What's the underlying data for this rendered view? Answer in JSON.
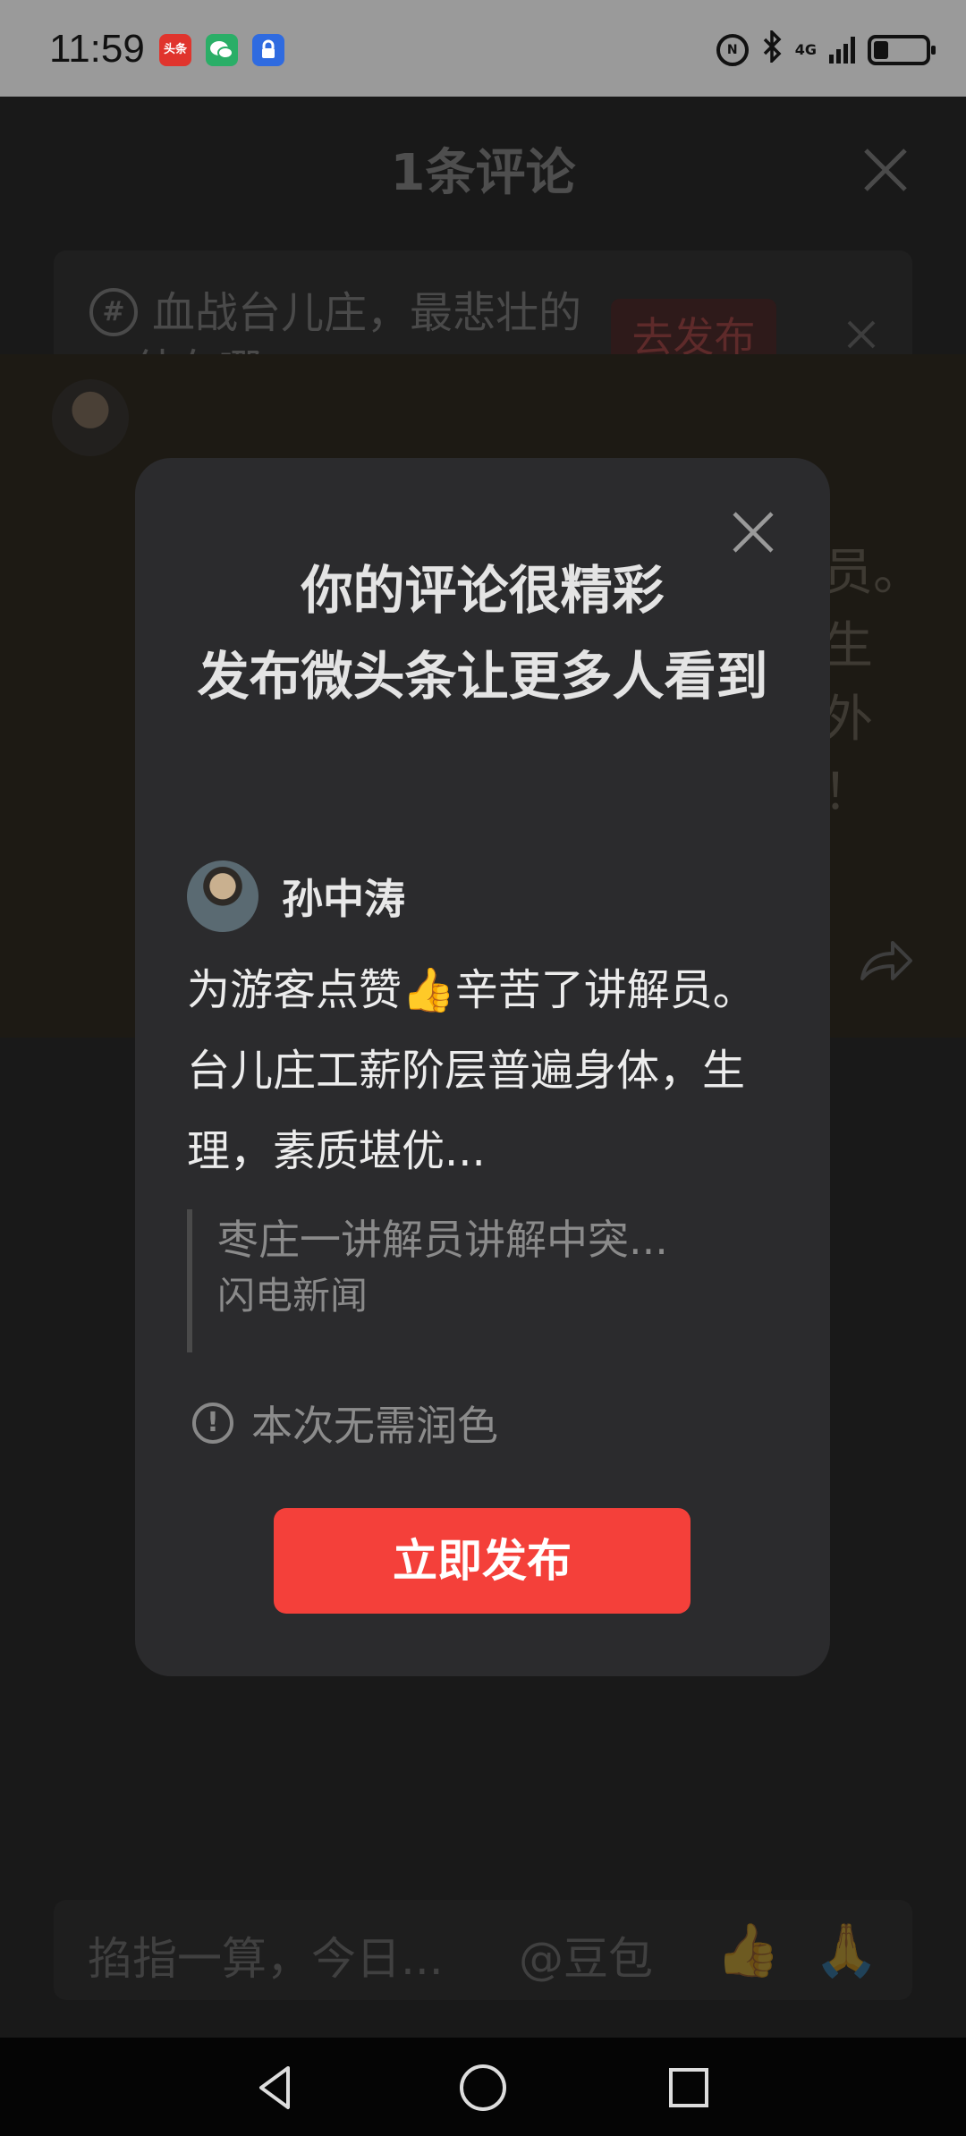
{
  "status_bar": {
    "time": "11:59",
    "app_icons": [
      "toutiao-icon",
      "wechat-icon",
      "lock-app-icon"
    ],
    "toutiao_label": "头条",
    "nfc_label": "N",
    "network": "4G"
  },
  "sheet": {
    "title": "1条评论",
    "topic": {
      "hash": "#",
      "text": "血战台儿庄，最悲壮的一仗在哪",
      "publish_label": "去发布"
    },
    "bg_text": "员。\n生\n外\n！"
  },
  "modal": {
    "title": "你的评论很精彩\n发布微头条让更多人看到",
    "author_name": "孙中涛",
    "body": "为游客点赞👍辛苦了讲解员。台儿庄工薪阶层普遍身体，生理，素质堪优...",
    "quote_title": "枣庄一讲解员讲解中突...",
    "quote_source": "闪电新闻",
    "hint": "本次无需润色",
    "publish_button": "立即发布"
  },
  "input_bar": {
    "placeholder": "掐指一算，今日...",
    "mention": "@豆包",
    "emoji_1": "👍",
    "emoji_2": "🙏"
  },
  "nav_icons": [
    "back-icon",
    "home-icon",
    "recents-icon"
  ]
}
